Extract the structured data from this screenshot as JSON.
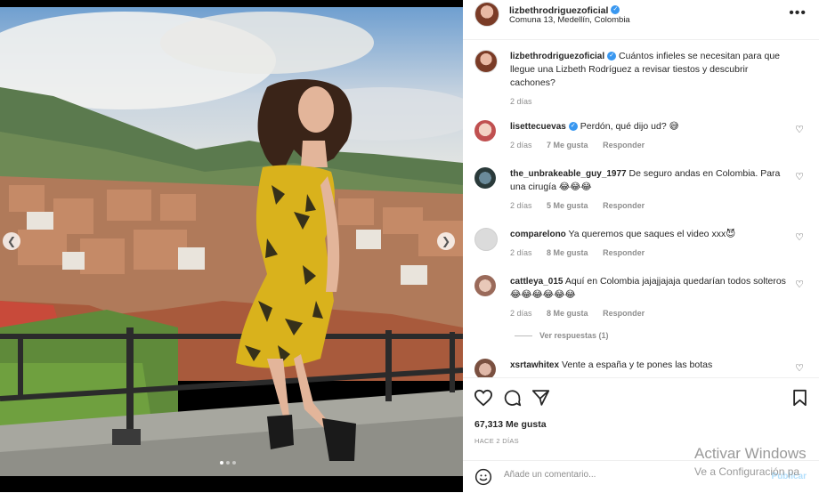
{
  "post": {
    "author": "lizbethrodriguezoficial",
    "location": "Comuna 13, Medellín, Colombia",
    "caption": "Cuántos infieles se necesitan para que llegue una Lizbeth Rodríguez a revisar tiestos y descubrir cachones?",
    "caption_time": "2 días",
    "likes": "67,313 Me gusta",
    "timestamp": "HACE 2 DÍAS"
  },
  "comments": [
    {
      "user": "lisettecuevas",
      "verified": true,
      "text": "Perdón, qué dijo ud? 😅",
      "time": "2 días",
      "likes": "7 Me gusta",
      "reply": "Responder"
    },
    {
      "user": "the_unbrakeable_guy_1977",
      "verified": false,
      "text": "De seguro andas en Colombia. Para una cirugía 😂😂😂",
      "time": "2 días",
      "likes": "5 Me gusta",
      "reply": "Responder"
    },
    {
      "user": "comparelono",
      "verified": false,
      "text": "Ya queremos que saques el video xxx😈",
      "time": "2 días",
      "likes": "8 Me gusta",
      "reply": "Responder"
    },
    {
      "user": "cattleya_015",
      "verified": false,
      "text": "Aquí en Colombia jajajjajaja quedarían todos solteros 😂😂😂😂😂😂",
      "time": "2 días",
      "likes": "8 Me gusta",
      "reply": "Responder"
    },
    {
      "user": "xsrtawhitex",
      "verified": false,
      "text": "Vente a españa y te pones las botas",
      "time": "",
      "likes": "",
      "reply": ""
    }
  ],
  "view_replies": "Ver respuestas (1)",
  "comment_input": {
    "placeholder": "Añade un comentario...",
    "publish": "Publicar"
  },
  "watermark": {
    "line1": "Activar Windows",
    "line2": "Ve a Configuración pa"
  },
  "icons": {
    "like": "heart-icon",
    "comment": "comment-icon",
    "share": "send-icon",
    "save": "bookmark-icon",
    "more": "more-icon",
    "emoji": "emoji-icon",
    "prev": "chevron-left-icon",
    "next": "chevron-right-icon"
  },
  "colors": {
    "verified": "#3897f0",
    "muted": "#8e8e8e",
    "publish": "#b2dffc"
  }
}
